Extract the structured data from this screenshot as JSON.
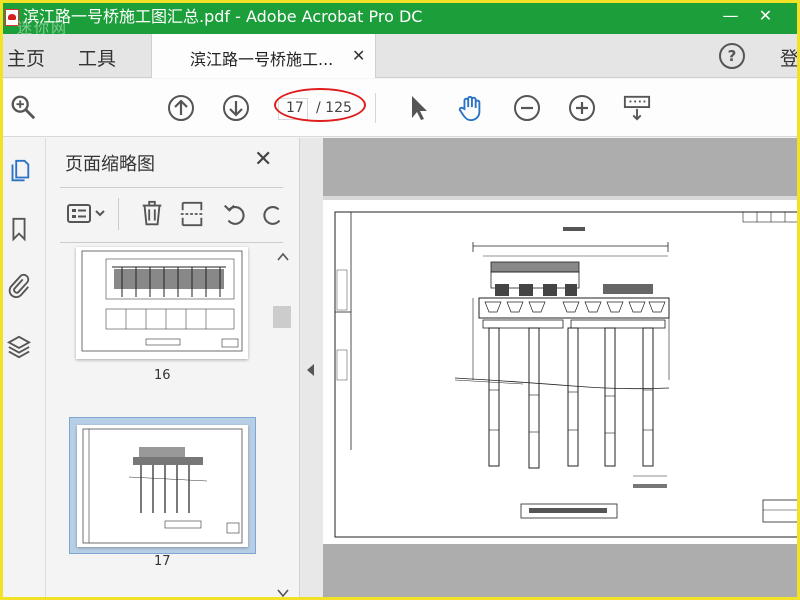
{
  "window": {
    "title": "滨江路一号桥施工图汇总.pdf - Adobe Acrobat Pro DC",
    "minimize_glyph": "—",
    "close_glyph": "✕",
    "watermark": "迷你网"
  },
  "tabs": {
    "home": "主页",
    "tools": "工具",
    "document": "滨江路一号桥施工...",
    "document_close_glyph": "✕",
    "login": "登"
  },
  "toolbar": {
    "current_page": "17",
    "total_pages": "/ 125",
    "help_glyph": "?"
  },
  "panel": {
    "title": "页面缩略图",
    "close_glyph": "✕",
    "thumbnails": [
      {
        "label": "16"
      },
      {
        "label": "17"
      }
    ]
  },
  "colors": {
    "titlebar": "#1c9f3a",
    "frame_border": "#f2e227",
    "annotation": "#e01e1e",
    "selection": "#b7cfe6",
    "hand_tool": "#2a72c4"
  },
  "icons": {
    "zoom": "search-icon",
    "prev_page": "arrow-up-circle-icon",
    "next_page": "arrow-down-circle-icon",
    "select": "cursor-arrow-icon",
    "hand": "hand-tool-icon",
    "zoom_out": "zoom-out-icon",
    "zoom_in": "zoom-in-icon",
    "more_tools": "keyboard-tools-icon"
  }
}
